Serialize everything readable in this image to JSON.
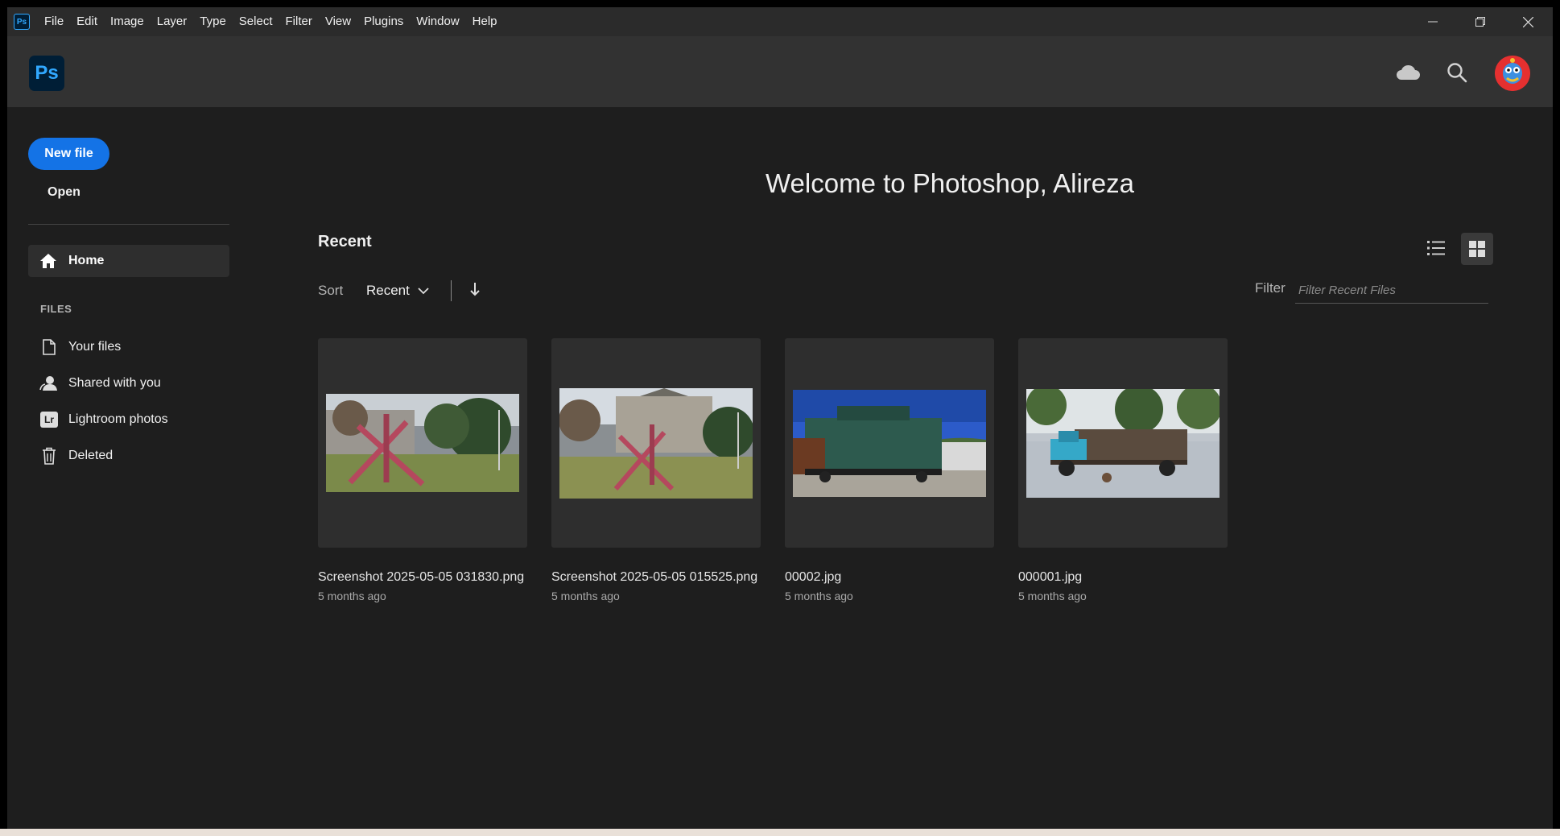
{
  "menubar": {
    "app_icon_text": "Ps",
    "items": [
      "File",
      "Edit",
      "Image",
      "Layer",
      "Type",
      "Select",
      "Filter",
      "View",
      "Plugins",
      "Window",
      "Help"
    ]
  },
  "header": {
    "logo_text": "Ps",
    "icons": [
      "cloud-icon",
      "search-icon",
      "avatar"
    ]
  },
  "sidebar": {
    "new_file_label": "New file",
    "open_label": "Open",
    "home_label": "Home",
    "files_heading": "FILES",
    "items": [
      {
        "label": "Your files",
        "icon": "file-icon"
      },
      {
        "label": "Shared with you",
        "icon": "shared-user-icon"
      },
      {
        "label": "Lightroom photos",
        "icon": "lightroom-icon",
        "icon_text": "Lr"
      },
      {
        "label": "Deleted",
        "icon": "trash-icon"
      }
    ]
  },
  "main": {
    "welcome": "Welcome to Photoshop, Alireza",
    "recent_heading": "Recent",
    "sort_label": "Sort",
    "sort_value": "Recent",
    "filter_label": "Filter",
    "filter_placeholder": "Filter Recent Files",
    "files": [
      {
        "name": "Screenshot 2025-05-05 031830.png",
        "time": "5 months ago"
      },
      {
        "name": "Screenshot 2025-05-05 015525.png",
        "time": "5 months ago"
      },
      {
        "name": "00002.jpg",
        "time": "5 months ago"
      },
      {
        "name": "000001.jpg",
        "time": "5 months ago"
      }
    ]
  },
  "colors": {
    "accent": "#1473e6",
    "ps_blue": "#31a8ff",
    "ps_dark": "#001e36",
    "background": "#1e1e1e",
    "header": "#323232"
  }
}
